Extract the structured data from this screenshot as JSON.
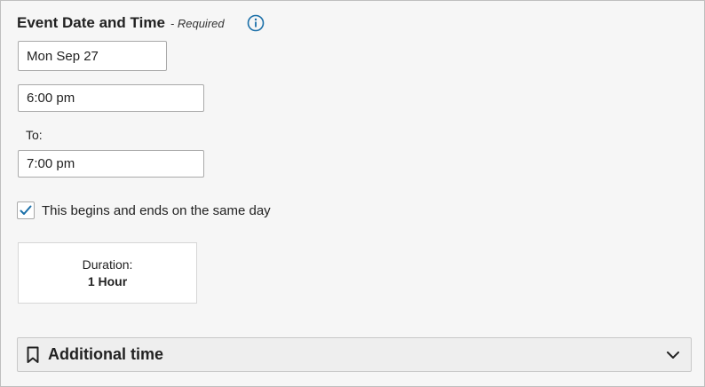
{
  "section": {
    "title": "Event Date and Time",
    "required_note": "- Required",
    "info_icon": "info-icon"
  },
  "date": {
    "value": "Mon Sep 27"
  },
  "start_time": {
    "value": "6:00 pm"
  },
  "end_time": {
    "label": "To:",
    "value": "7:00 pm"
  },
  "same_day": {
    "checked": true,
    "label": "This begins and ends on the same day"
  },
  "duration": {
    "label": "Duration:",
    "value": "1 Hour"
  },
  "additional": {
    "label": "Additional time",
    "icon": "bookmark-icon",
    "expand_icon": "chevron-down-icon"
  },
  "colors": {
    "accent": "#1a6fa8",
    "panel_bg": "#f6f6f6"
  }
}
